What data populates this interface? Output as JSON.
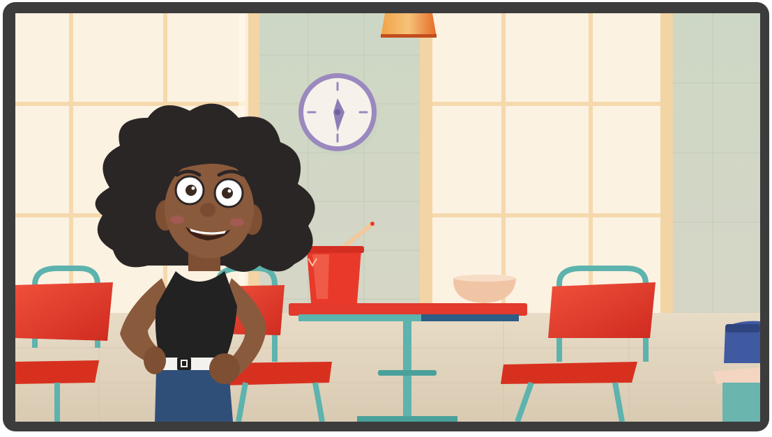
{
  "scene": {
    "palette": {
      "frame": "#3c3c3c",
      "wall": "#f3e9d6",
      "window_pane": "#fbf3e4",
      "window_frame": "#f7dfb8",
      "tile_wall": "#cfd8c6",
      "floor": "#e9dfcf",
      "chair_red": "#e8392a",
      "metal_teal": "#5db3ad",
      "table_top": "#e23a2c",
      "clock_rim": "#a592c4",
      "hair": "#2b2626",
      "skin": "#8a5a3c",
      "tank_top": "#222222",
      "jeans": "#2f4f78",
      "lamp": "#e8782c"
    },
    "objects": {
      "clock": "clock",
      "lamp": "pendant-lamp",
      "cup": "soda-cup",
      "bowl": "bowl",
      "trash_can": "trash-can"
    }
  }
}
